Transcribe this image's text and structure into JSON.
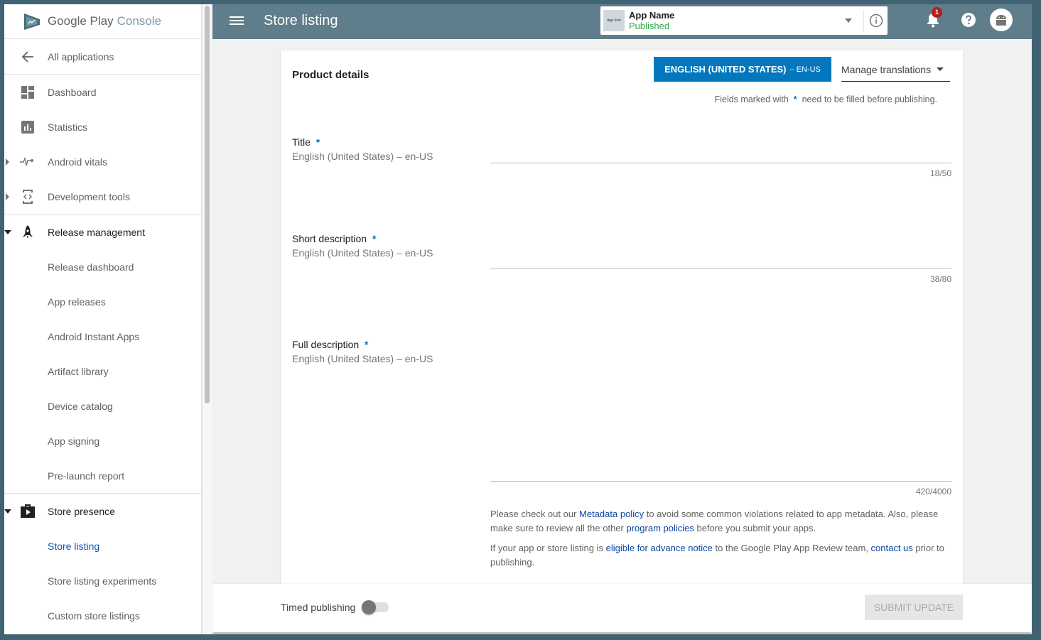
{
  "brand": {
    "google_play": "Google Play",
    "console": "Console"
  },
  "sidebar": {
    "back": {
      "label": "All applications",
      "icon": "arrow-left-icon"
    },
    "items": [
      {
        "label": "Dashboard",
        "icon": "dashboard-icon"
      },
      {
        "label": "Statistics",
        "icon": "bar-chart-icon"
      },
      {
        "label": "Android vitals",
        "icon": "pulse-icon",
        "expandable": true
      },
      {
        "label": "Development tools",
        "icon": "code-icon",
        "expandable": true
      }
    ],
    "release_management": {
      "label": "Release management",
      "icon": "rocket-icon",
      "children": [
        "Release dashboard",
        "App releases",
        "Android Instant Apps",
        "Artifact library",
        "Device catalog",
        "App signing",
        "Pre-launch report"
      ]
    },
    "store_presence": {
      "label": "Store presence",
      "icon": "shopping-bag-icon",
      "children": [
        "Store listing",
        "Store listing experiments",
        "Custom store listings"
      ],
      "active": "Store listing"
    }
  },
  "header": {
    "title": "Store listing",
    "app": {
      "icon_text": "App Icon",
      "name": "App Name",
      "status": "Published"
    },
    "notification_count": "1"
  },
  "card": {
    "title": "Product details",
    "language_button": {
      "label": "ENGLISH (UNITED STATES)",
      "code": "– EN-US"
    },
    "manage_translations": "Manage translations",
    "fields_note": {
      "before": "Fields marked with",
      "star": "*",
      "after": "need to be filled before publishing."
    },
    "fields": [
      {
        "label": "Title",
        "sub": "English (United States) – en-US",
        "counter": "18/50",
        "value": ""
      },
      {
        "label": "Short description",
        "sub": "English (United States) – en-US",
        "counter": "38/80",
        "value": ""
      },
      {
        "label": "Full description",
        "sub": "English (United States) – en-US",
        "counter": "420/4000",
        "value": ""
      }
    ],
    "policy": {
      "p1_a": "Please check out our",
      "p1_link1": "Metadata policy",
      "p1_b": "to avoid some common violations related to app metadata. Also, please make sure to review all the other",
      "p1_link2": "program policies",
      "p1_c": "before you submit your apps.",
      "p2_a": "If your app or store listing is",
      "p2_link1": "eligible for advance notice",
      "p2_b": "to the Google Play App Review team,",
      "p2_link2": "contact us",
      "p2_c": "prior to publishing."
    }
  },
  "footer": {
    "timed_publishing": "Timed publishing",
    "timed_publishing_on": false,
    "submit": "SUBMIT UPDATE"
  },
  "colors": {
    "header": "#607d8b",
    "accent": "#0277bd",
    "active_nav": "#0d5aa7",
    "published": "#34a853",
    "badge": "#b71c1c"
  }
}
